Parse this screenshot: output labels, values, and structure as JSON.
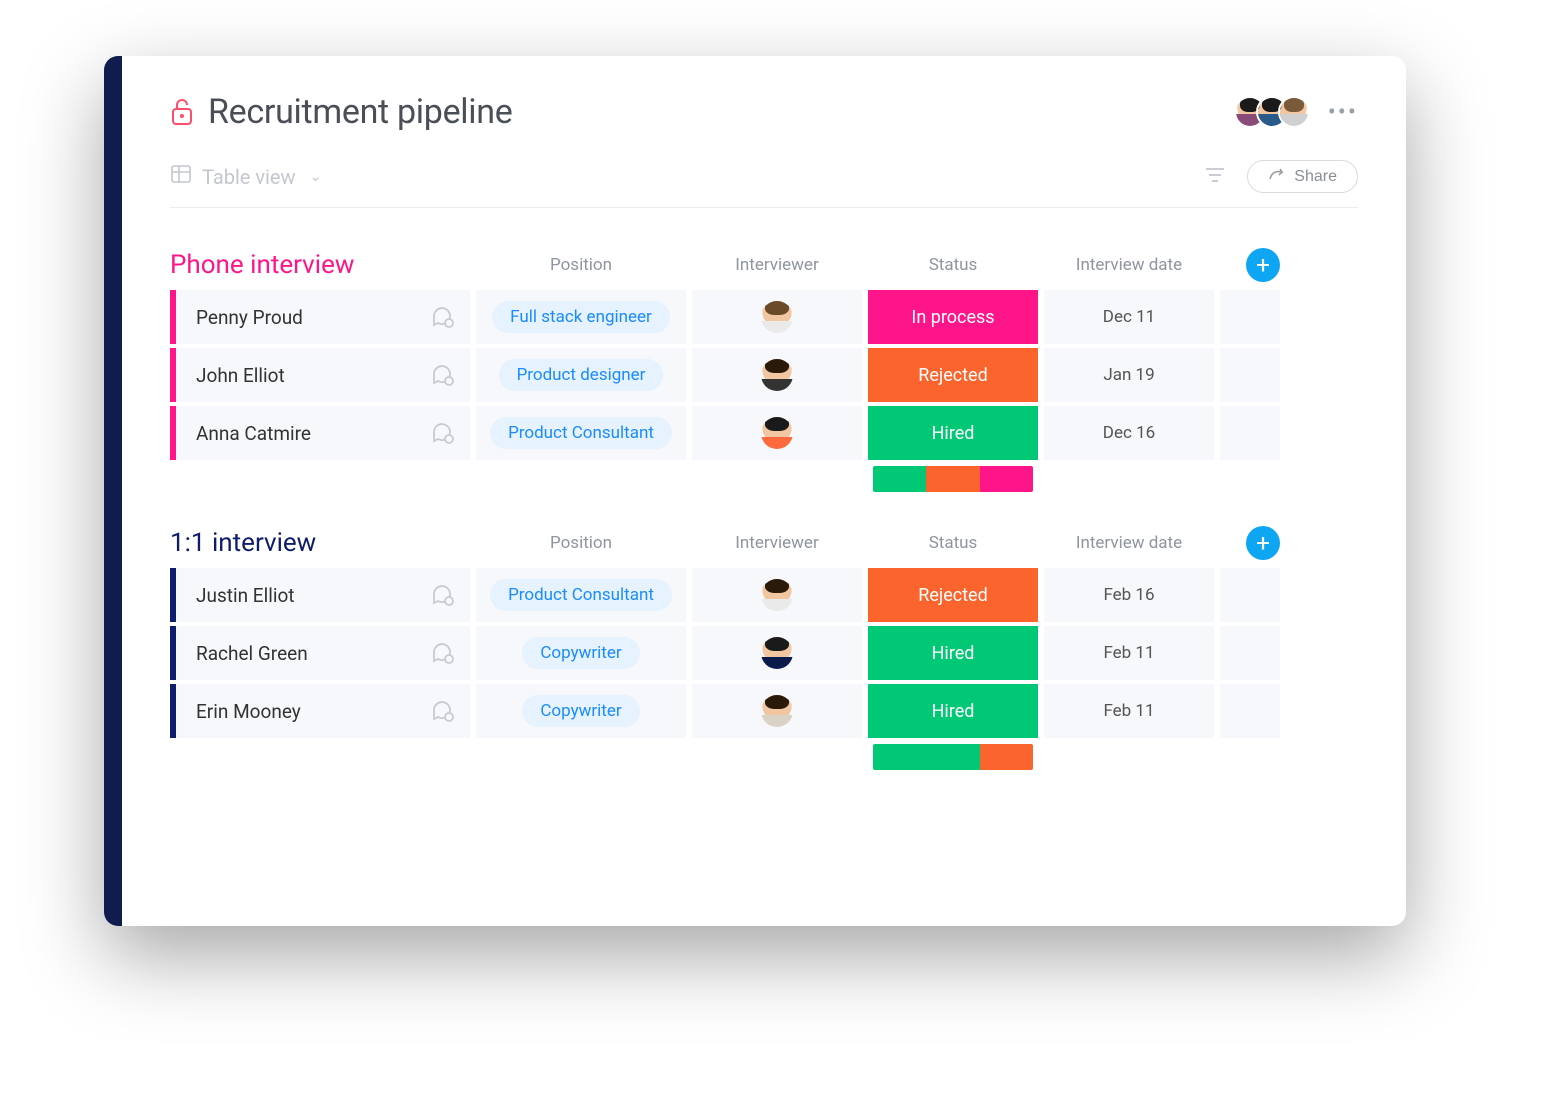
{
  "header": {
    "title": "Recruitment pipeline"
  },
  "toolbar": {
    "view_label": "Table view",
    "share_label": "Share"
  },
  "columns": {
    "position": "Position",
    "interviewer": "Interviewer",
    "status": "Status",
    "date": "Interview date"
  },
  "status_colors": {
    "In process": "#ff158a",
    "Rejected": "#fb642d",
    "Hired": "#00c875"
  },
  "groups": [
    {
      "title": "Phone interview",
      "color": "#ff158a",
      "title_color": "#ff158a",
      "rows": [
        {
          "name": "Penny Proud",
          "position": "Full stack engineer",
          "status": "In process",
          "date": "Dec 11",
          "hair": "#6b4a2a",
          "shirt": "#eaeaea"
        },
        {
          "name": "John Elliot",
          "position": "Product designer",
          "status": "Rejected",
          "date": "Jan 19",
          "hair": "#2a1a0a",
          "shirt": "#333"
        },
        {
          "name": "Anna Catmire",
          "position": "Product Consultant",
          "status": "Hired",
          "date": "Dec 16",
          "hair": "#1a1a1a",
          "shirt": "#ff6a3d"
        }
      ],
      "summary": [
        {
          "color": "#00c875",
          "flex": 1
        },
        {
          "color": "#fb642d",
          "flex": 1
        },
        {
          "color": "#ff158a",
          "flex": 1
        }
      ]
    },
    {
      "title": "1:1 interview",
      "color": "#0f1c6b",
      "title_color": "#0f1c6b",
      "rows": [
        {
          "name": "Justin Elliot",
          "position": "Product Consultant",
          "status": "Rejected",
          "date": "Feb 16",
          "hair": "#2a1a0a",
          "shirt": "#eaeaea"
        },
        {
          "name": "Rachel Green",
          "position": "Copywriter",
          "status": "Hired",
          "date": "Feb 11",
          "hair": "#1a1a1a",
          "shirt": "#0a1a4a"
        },
        {
          "name": "Erin Mooney",
          "position": "Copywriter",
          "status": "Hired",
          "date": "Feb 11",
          "hair": "#2a1a0a",
          "shirt": "#d9d2c5"
        }
      ],
      "summary": [
        {
          "color": "#00c875",
          "flex": 2
        },
        {
          "color": "#fb642d",
          "flex": 1
        }
      ]
    }
  ]
}
